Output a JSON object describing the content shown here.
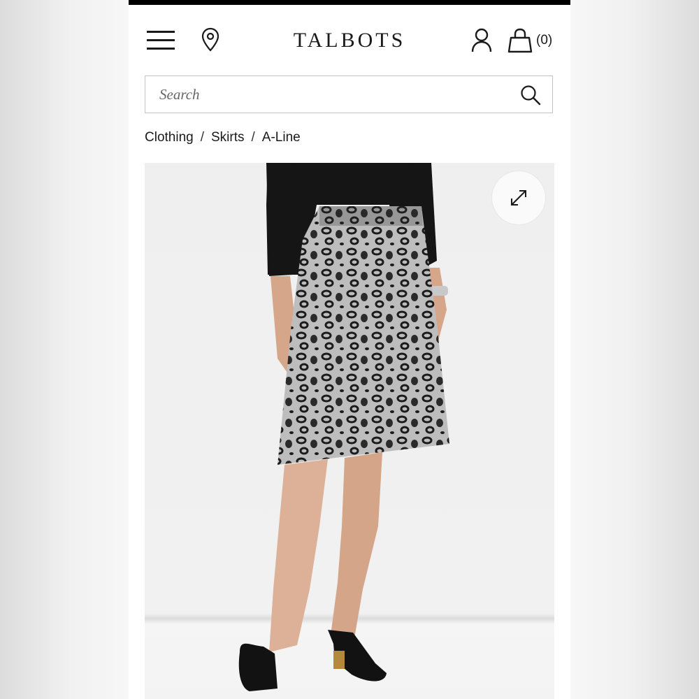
{
  "header": {
    "brand": "TALBOTS",
    "bag_count": "(0)",
    "icons": {
      "menu": "hamburger-menu-icon",
      "location": "map-pin-icon",
      "account": "user-icon",
      "bag": "shopping-bag-icon"
    }
  },
  "search": {
    "placeholder": "Search",
    "icon": "search-icon"
  },
  "breadcrumb": {
    "items": [
      "Clothing",
      "Skirts",
      "A-Line"
    ],
    "separator": "/"
  },
  "product": {
    "image_alt": "Leopard print A-line skirt",
    "expand_icon": "expand-icon"
  },
  "colors": {
    "text": "#1a1a1a",
    "border": "#c4c4c4",
    "image_bg": "#efefef"
  }
}
